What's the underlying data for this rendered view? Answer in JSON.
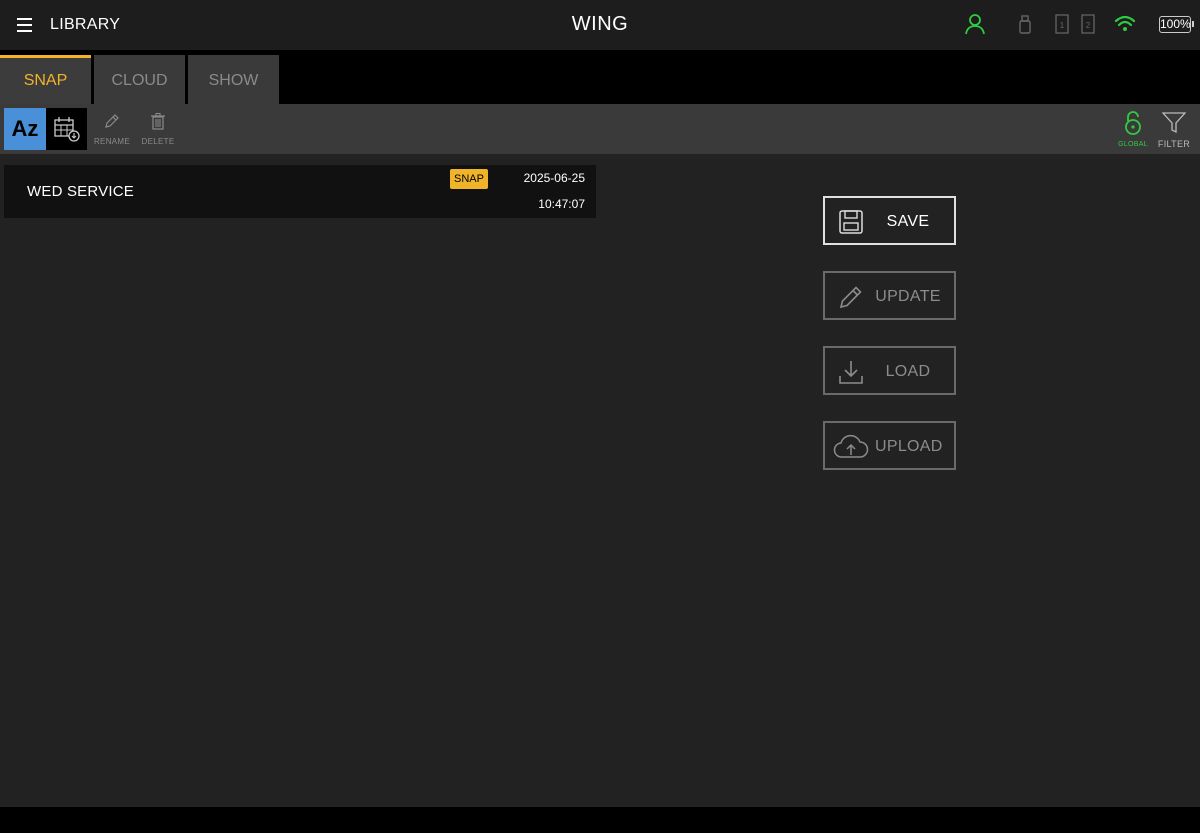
{
  "header": {
    "menu_icon": "hamburger-icon",
    "title": "LIBRARY",
    "brand": "WING",
    "battery": "100%",
    "user_color": "#2ecc40",
    "wifi_color": "#2ecc40",
    "card_1": "1",
    "card_2": "2"
  },
  "tabs": [
    {
      "label": "SNAP",
      "active": true
    },
    {
      "label": "CLOUD",
      "active": false
    },
    {
      "label": "SHOW",
      "active": false
    }
  ],
  "toolbar": {
    "sort_alpha": "Az",
    "sort_date_icon": "calendar-sort-icon",
    "rename": "RENAME",
    "delete": "DELETE",
    "global": "GLOBAL",
    "filter": "FILTER"
  },
  "list": [
    {
      "name": "WED SERVICE",
      "badge": "SNAP",
      "date": "2025-06-25",
      "time": "10:47:07"
    }
  ],
  "actions": {
    "save": "SAVE",
    "update": "UPDATE",
    "load": "LOAD",
    "upload": "UPLOAD"
  },
  "colors": {
    "accent": "#f0b429",
    "sort_active": "#4a90d9",
    "global_green": "#2ecc40"
  }
}
